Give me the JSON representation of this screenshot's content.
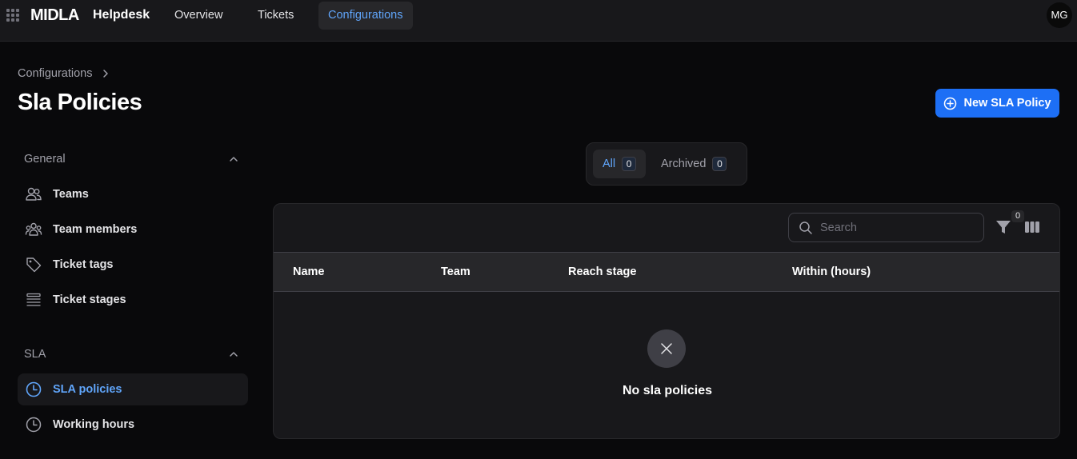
{
  "topbar": {
    "brand": "MIDLA",
    "product": "Helpdesk",
    "nav": [
      {
        "label": "Overview"
      },
      {
        "label": "Tickets"
      },
      {
        "label": "Configurations",
        "active": true
      }
    ],
    "avatar_initials": "MG"
  },
  "header": {
    "breadcrumb": "Configurations",
    "title": "Sla Policies",
    "new_button_label": "New SLA Policy"
  },
  "sidebar": {
    "sections": [
      {
        "title": "General",
        "items": [
          {
            "label": "Teams",
            "icon": "users-icon"
          },
          {
            "label": "Team members",
            "icon": "user-group-icon"
          },
          {
            "label": "Ticket tags",
            "icon": "tag-icon"
          },
          {
            "label": "Ticket stages",
            "icon": "list-icon"
          }
        ]
      },
      {
        "title": "SLA",
        "items": [
          {
            "label": "SLA policies",
            "icon": "clock-icon",
            "active": true
          },
          {
            "label": "Working hours",
            "icon": "clock-icon"
          }
        ]
      }
    ]
  },
  "tabs": [
    {
      "label": "All",
      "count": "0",
      "active": true
    },
    {
      "label": "Archived",
      "count": "0"
    }
  ],
  "table": {
    "search_placeholder": "Search",
    "filter_count": "0",
    "columns": [
      "Name",
      "Team",
      "Reach stage",
      "Within (hours)"
    ],
    "empty_text": "No sla policies"
  },
  "colors": {
    "accent": "#1d6ff5",
    "active_text": "#60a5fa",
    "background": "#09090b",
    "surface": "#18181b"
  }
}
